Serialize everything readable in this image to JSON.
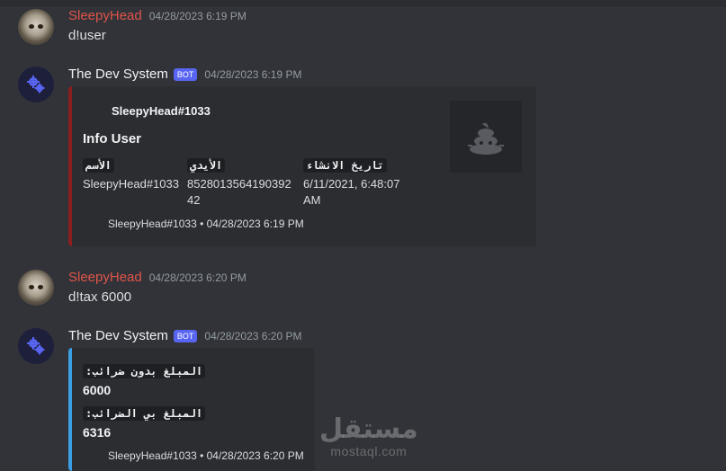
{
  "messages": [
    {
      "author": "SleepyHead",
      "timestamp": "04/28/2023 6:19 PM",
      "content": "d!user"
    },
    {
      "author": "The Dev System",
      "bot_tag": "BOT",
      "timestamp": "04/28/2023 6:19 PM",
      "embed": {
        "accent_color": "#8b1e1e",
        "author": "SleepyHead#1033",
        "title": "Info User",
        "fields": [
          {
            "name": "الأسم",
            "value": "SleepyHead#1033"
          },
          {
            "name": "الأيدي",
            "value": "852801356419039242"
          },
          {
            "name": "تاريخ الانشاء",
            "value": "6/11/2021, 6:48:07 AM"
          }
        ],
        "footer": "SleepyHead#1033 • 04/28/2023 6:19 PM"
      }
    },
    {
      "author": "SleepyHead",
      "timestamp": "04/28/2023 6:20 PM",
      "content": "d!tax 6000"
    },
    {
      "author": "The Dev System",
      "bot_tag": "BOT",
      "timestamp": "04/28/2023 6:20 PM",
      "embed": {
        "accent_color": "#3a9ee4",
        "fields": [
          {
            "name": "المبلغ بدون ضرائب:",
            "value": "6000"
          },
          {
            "name": "المبلغ بي الضرائب:",
            "value": "6316"
          }
        ],
        "footer": "SleepyHead#1033 • 04/28/2023 6:20 PM"
      }
    }
  ],
  "watermark": {
    "main": "مستقل",
    "sub": "mostaql.com"
  },
  "colors": {
    "background": "#313338",
    "embed_bg": "#2b2d31",
    "user_name": "#e0544b",
    "bot_tag": "#5865f2"
  },
  "icons": {
    "bot_avatar": "gears-icon",
    "embed_thumbnail": "poop-emoji-icon"
  }
}
